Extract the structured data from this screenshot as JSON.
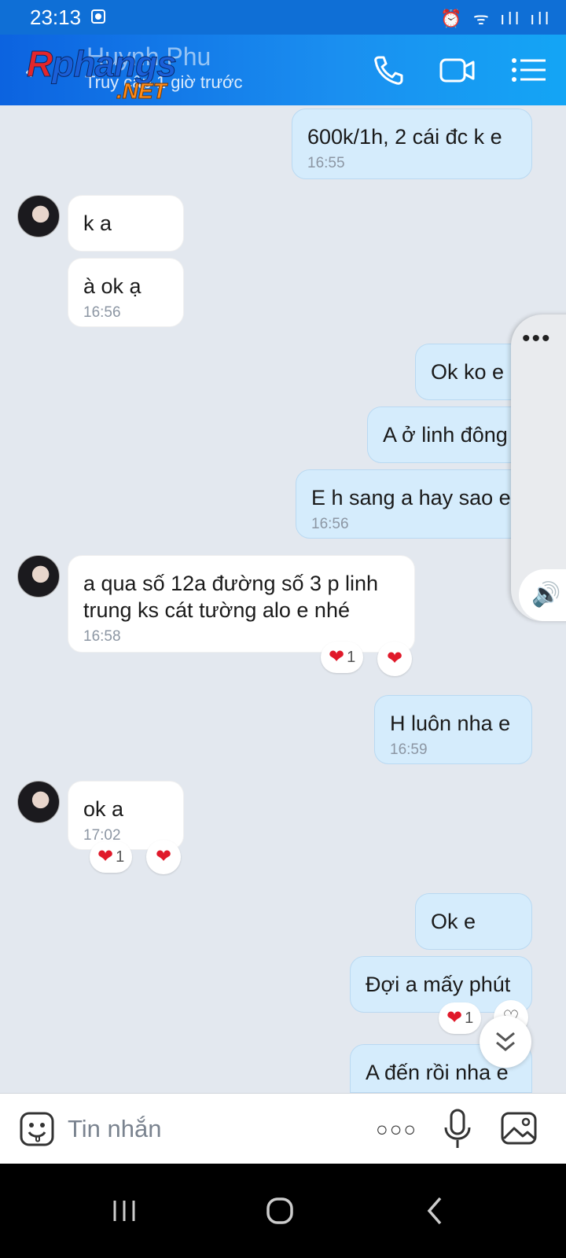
{
  "status_bar": {
    "time": "23:13",
    "sys_icons": "⏰ ᯤ ıll ıll"
  },
  "header": {
    "back_icon": "back-arrow-icon",
    "contact_name": "Huynh Phu",
    "last_seen": "Truy cập 1 giờ trước",
    "watermark_main": "phangs",
    "watermark_r": "R",
    "watermark_net": ".NET"
  },
  "messages": [
    {
      "dir": "out",
      "text": "600k/1h, 2 cái đc k e",
      "time": "16:55"
    },
    {
      "dir": "in",
      "text": "k a",
      "time": ""
    },
    {
      "dir": "in",
      "text": "à ok ạ",
      "time": "16:56"
    },
    {
      "dir": "out",
      "text": "Ok ko e",
      "time": ""
    },
    {
      "dir": "out",
      "text": "A ở linh đông",
      "time": ""
    },
    {
      "dir": "out",
      "text": "E h sang a hay sao e",
      "time": "16:56"
    },
    {
      "dir": "in",
      "text": "a qua số 12a đường số 3 p linh trung ks cát tường alo e nhé",
      "time": "16:58",
      "reaction_count": "1"
    },
    {
      "dir": "out",
      "text": "H luôn nha e",
      "time": "16:59"
    },
    {
      "dir": "in",
      "text": "ok a",
      "time": "17:02",
      "reaction_count": "1"
    },
    {
      "dir": "out",
      "text": "Ok e",
      "time": ""
    },
    {
      "dir": "out",
      "text": "Đợi a mấy phút",
      "time": "",
      "reaction_count": "1"
    },
    {
      "dir": "out",
      "text": "A đến rồi nha e",
      "time": ""
    }
  ],
  "side_panel": {
    "dots": "•••",
    "speaker": "🔊"
  },
  "input": {
    "placeholder": "Tin nhắn",
    "more": "○○○"
  },
  "colors": {
    "header_start": "#0c63e0",
    "header_end": "#14a5f5",
    "outgoing_bubble": "#d5ecfc",
    "incoming_bubble": "#ffffff",
    "background": "#e3e8ef",
    "heart": "#e0192a"
  }
}
